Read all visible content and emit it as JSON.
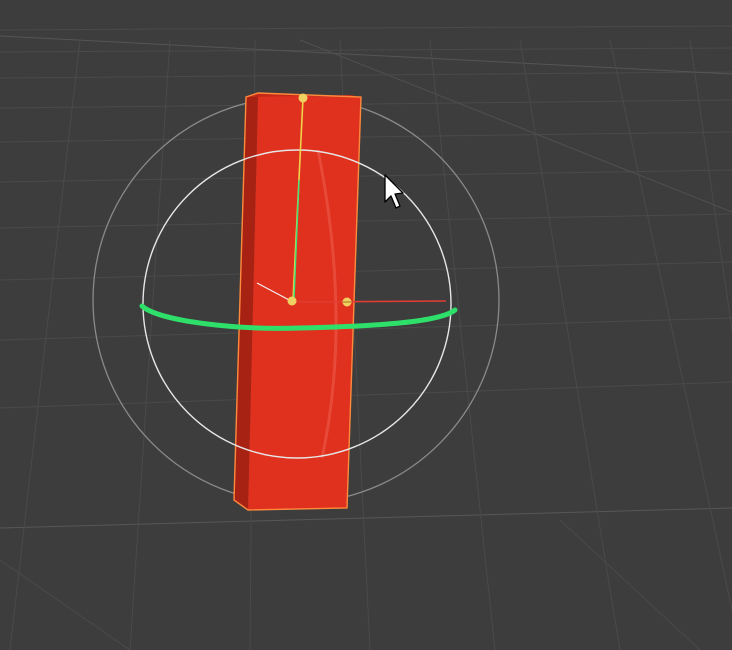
{
  "viewport": {
    "background": "#3d3d3d",
    "grid_color": "#4a4a4a",
    "grid_major_color": "#555555"
  },
  "object": {
    "name": "",
    "type": "box",
    "color": "#e0301e",
    "shade_color": "#a82214",
    "outline_color": "#ff8a3c",
    "selected": true
  },
  "rotate_gizmo": {
    "outer_ring_color": "#8a8a8a",
    "inner_ring_color": "#e6e6e6",
    "active_axis": "y",
    "active_axis_color": "#2ee06a",
    "x_axis_color": "#e03c32",
    "y_axis_color": "#f0d24a",
    "pivot_color": "#f0d060"
  },
  "cursor": {
    "icon": "arrow-cursor-icon"
  }
}
